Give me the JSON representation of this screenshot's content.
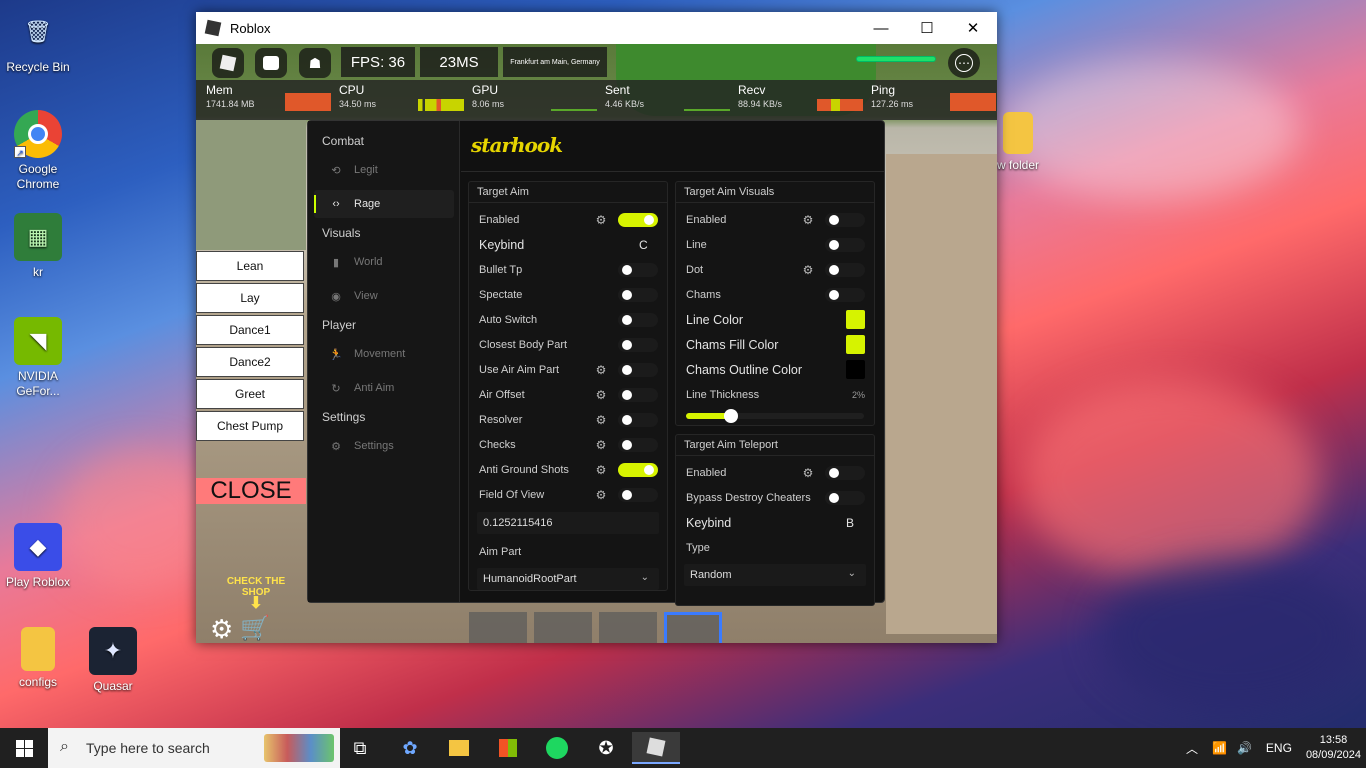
{
  "desktop": {
    "icons": [
      {
        "label": "Recycle Bin",
        "glyph": "🗑"
      },
      {
        "label": "Google Chrome",
        "glyph": "◎"
      },
      {
        "label": "kr",
        "glyph": "▦"
      },
      {
        "label": "NVIDIA GeFor...",
        "glyph": "◥"
      },
      {
        "label": "Play Roblox",
        "glyph": "◆"
      },
      {
        "label": "configs",
        "glyph": "▬"
      },
      {
        "label": "Quasar",
        "glyph": "✦"
      },
      {
        "label": "w folder",
        "glyph": "▬"
      }
    ]
  },
  "window": {
    "title": "Roblox",
    "minimize": "—",
    "maximize": "☐",
    "close": "✕"
  },
  "topbar": {
    "fps": "FPS: 36",
    "ms": "23MS",
    "server": "Frankfurt am Main, Germany",
    "menu_glyph": "⋯"
  },
  "perf": [
    {
      "name": "Mem",
      "value": "1741.84 MB"
    },
    {
      "name": "CPU",
      "value": "34.50 ms"
    },
    {
      "name": "GPU",
      "value": "8.06 ms"
    },
    {
      "name": "Sent",
      "value": "4.46 KB/s"
    },
    {
      "name": "Recv",
      "value": "88.94 KB/s"
    },
    {
      "name": "Ping",
      "value": "127.26 ms"
    }
  ],
  "emotes": [
    "Lean",
    "Lay",
    "Dance1",
    "Dance2",
    "Greet",
    "Chest Pump"
  ],
  "close_label": "CLOSE",
  "shop_hint": "CHECK THE SHOP",
  "menu": {
    "logo": "starhook",
    "sections": {
      "combat": "Combat",
      "visuals": "Visuals",
      "player": "Player",
      "settings": "Settings"
    },
    "items": {
      "legit": "Legit",
      "rage": "Rage",
      "world": "World",
      "view": "View",
      "movement": "Movement",
      "anti_aim": "Anti Aim",
      "settings": "Settings"
    },
    "target_aim": {
      "title": "Target Aim",
      "enabled": "Enabled",
      "keybind": "Keybind",
      "keybind_value": "C",
      "bullet_tp": "Bullet Tp",
      "spectate": "Spectate",
      "auto_switch": "Auto Switch",
      "closest_body_part": "Closest Body Part",
      "use_air_aim_part": "Use Air Aim Part",
      "air_offset": "Air Offset",
      "resolver": "Resolver",
      "checks": "Checks",
      "anti_ground_shots": "Anti Ground Shots",
      "field_of_view": "Field Of View",
      "fov_value": "0.1252115416",
      "aim_part_label": "Aim Part",
      "aim_part_value": "HumanoidRootPart"
    },
    "visuals": {
      "title": "Target Aim Visuals",
      "enabled": "Enabled",
      "line": "Line",
      "dot": "Dot",
      "chams": "Chams",
      "line_color": "Line Color",
      "chams_fill_color": "Chams Fill Color",
      "chams_outline_color": "Chams Outline Color",
      "line_thickness": "Line Thickness",
      "line_thickness_value": "2%",
      "line_thickness_level": 0.25,
      "color_accent": "#d6f300",
      "color_outline": "#000000"
    },
    "teleport": {
      "title": "Target Aim Teleport",
      "enabled": "Enabled",
      "bypass": "Bypass Destroy Cheaters",
      "keybind": "Keybind",
      "keybind_value": "B",
      "type_label": "Type",
      "type_value": "Random"
    }
  },
  "taskbar": {
    "search_placeholder": "Type here to search",
    "lang": "ENG",
    "time": "13:58",
    "date": "08/09/2024"
  }
}
